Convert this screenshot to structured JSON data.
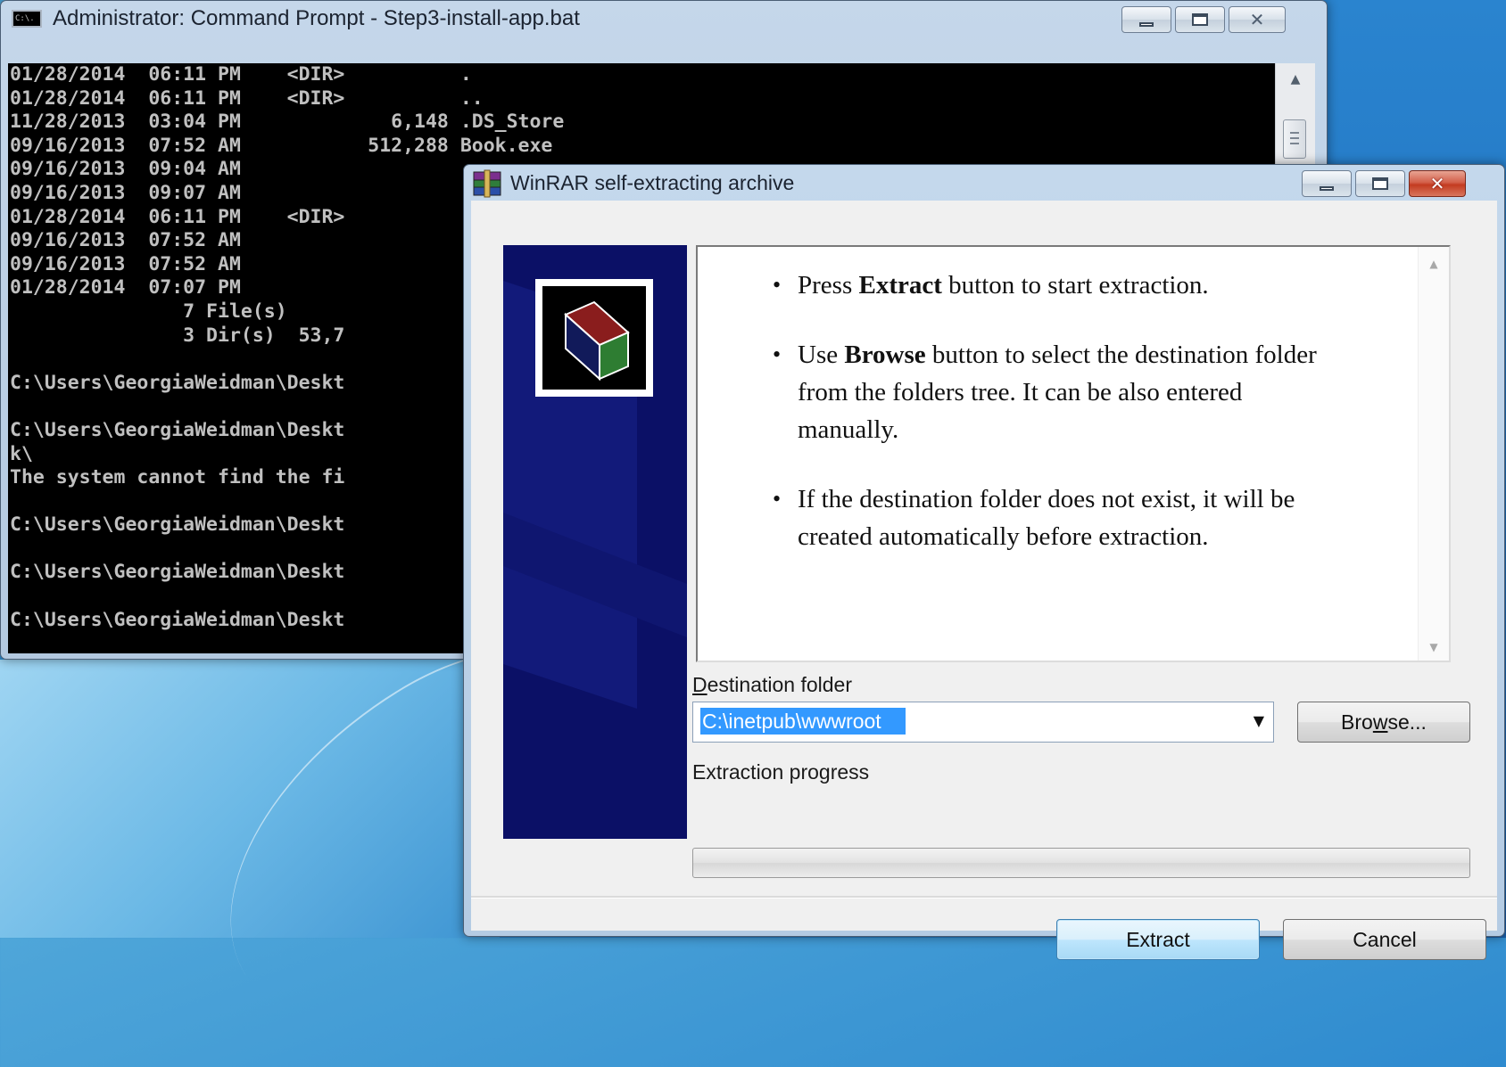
{
  "cmd": {
    "title": "Administrator: Command Prompt - Step3-install-app.bat",
    "icon_label": "C:\\.",
    "lines": [
      "01/28/2014  06:11 PM    <DIR>          .",
      "01/28/2014  06:11 PM    <DIR>          ..",
      "11/28/2013  03:04 PM             6,148 .DS_Store",
      "09/16/2013  07:52 AM           512,288 Book.exe",
      "09/16/2013  09:04 AM",
      "09/16/2013  09:07 AM",
      "01/28/2014  06:11 PM    <DIR>",
      "09/16/2013  07:52 AM",
      "09/16/2013  07:52 AM",
      "01/28/2014  07:07 PM",
      "               7 File(s)",
      "               3 Dir(s)  53,7",
      "",
      "C:\\Users\\GeorgiaWeidman\\Deskt",
      "",
      "C:\\Users\\GeorgiaWeidman\\Deskt",
      "k\\",
      "The system cannot find the fi",
      "",
      "C:\\Users\\GeorgiaWeidman\\Deskt",
      "",
      "C:\\Users\\GeorgiaWeidman\\Deskt",
      "",
      "C:\\Users\\GeorgiaWeidman\\Deskt"
    ],
    "scrollbar": {
      "position_fraction": 0.05
    }
  },
  "rar": {
    "title": "WinRAR self-extracting archive",
    "info": {
      "item1": {
        "prefix": "Press ",
        "bold": "Extract",
        "suffix": " button to start extraction."
      },
      "item2": {
        "prefix": "Use ",
        "bold": "Browse",
        "suffix": " button to select the destination folder from the folders tree. It can be also entered manually."
      },
      "item3": {
        "text": "If the destination folder does not exist, it will be created automatically before extraction."
      }
    },
    "destination": {
      "label": "Destination folder",
      "label_accesskey": "D",
      "label_rest": "estination folder",
      "value": "C:\\inetpub\\wwwroot"
    },
    "browse_label": "Browse...",
    "browse_parts": {
      "before": "Bro",
      "accesskey": "w",
      "after": "se..."
    },
    "progress": {
      "label": "Extraction progress",
      "percent": 0
    },
    "extract_label": "Extract",
    "cancel_label": "Cancel"
  },
  "colors": {
    "console_bg": "#000000",
    "console_text": "#c0c0c0",
    "banner_bg": "#0b1066",
    "selection": "#3399ff",
    "close_button": "#c9452a"
  }
}
